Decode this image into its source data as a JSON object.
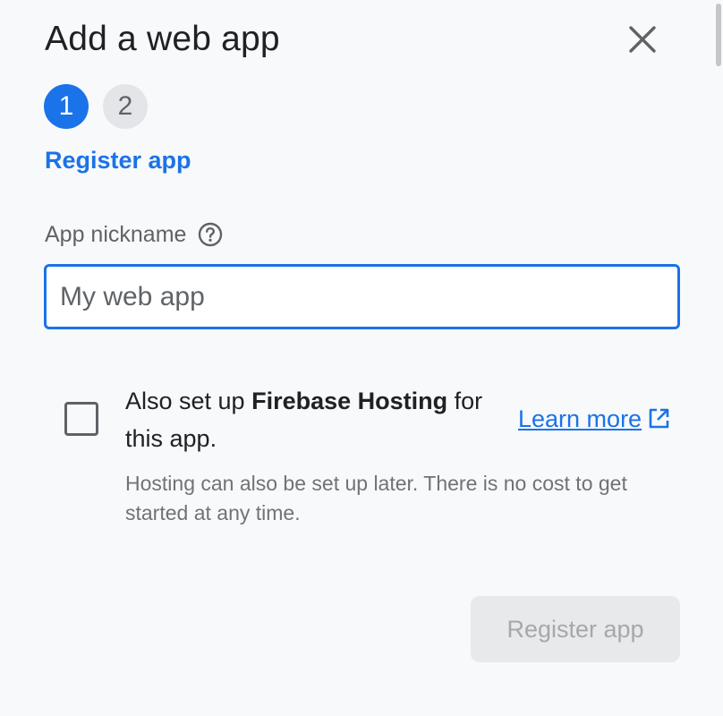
{
  "dialog": {
    "title": "Add a web app",
    "close_icon": "close-icon"
  },
  "stepper": {
    "steps": [
      {
        "number": "1",
        "state": "active"
      },
      {
        "number": "2",
        "state": "inactive"
      }
    ],
    "current_step_label": "Register app"
  },
  "form": {
    "nickname_label": "App nickname",
    "help_icon": "help-circle-icon",
    "nickname_placeholder": "My web app",
    "nickname_value": ""
  },
  "hosting": {
    "checkbox_checked": false,
    "text_before": "Also set up ",
    "text_bold": "Firebase Hosting",
    "text_after": " for this app.",
    "learn_more_label": "Learn more",
    "learn_more_icon": "open-in-new-icon",
    "hint": "Hosting can also be set up later. There is no cost to get started at any time."
  },
  "actions": {
    "register_label": "Register app",
    "register_disabled": true
  },
  "colors": {
    "accent": "#1a73e8",
    "background": "#f8f9fa",
    "muted_text": "#5f6368",
    "disabled_bg": "#e8e9ea",
    "disabled_text": "#a5a8ac"
  }
}
